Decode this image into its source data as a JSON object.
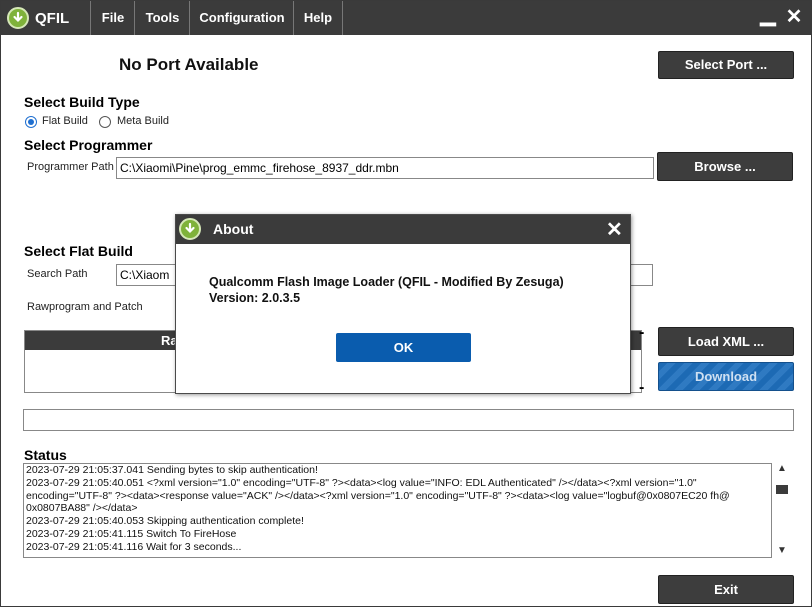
{
  "window": {
    "app_name": "QFIL",
    "minimize": "▁",
    "close": "✕"
  },
  "menu": [
    "File",
    "Tools",
    "Configuration",
    "Help"
  ],
  "port": {
    "status": "No Port Available",
    "select_button": "Select Port ..."
  },
  "build_type": {
    "heading": "Select Build Type",
    "options": [
      "Flat Build",
      "Meta Build"
    ],
    "selected": "Flat Build"
  },
  "programmer": {
    "heading": "Select Programmer",
    "label": "Programmer Path",
    "path": "C:\\Xiaomi\\Pine\\prog_emmc_firehose_8937_ddr.mbn",
    "browse_button": "Browse ..."
  },
  "flat_build": {
    "heading": "Select Flat Build",
    "search_label": "Search Path",
    "search_value": "C:\\Xiaom",
    "rawprogram_label": "Rawprogram and Patch",
    "table_header": "Ra",
    "load_xml_button": "Load XML ...",
    "download_button": "Download",
    "dash": "-"
  },
  "status": {
    "heading": "Status",
    "lines": [
      "2023-07-29 21:05:37.041     Sending bytes to skip authentication!",
      "2023-07-29 21:05:40.051     <?xml version=\"1.0\" encoding=\"UTF-8\" ?><data><log value=\"INFO: EDL Authenticated\" /></data><?xml version=\"1.0\"",
      "encoding=\"UTF-8\" ?><data><response value=\"ACK\" /></data><?xml version=\"1.0\" encoding=\"UTF-8\" ?><data><log value=\"logbuf@0x0807EC20 fh@",
      "0x0807BA88\" /></data>",
      "2023-07-29 21:05:40.053     Skipping authentication complete!",
      "2023-07-29 21:05:41.115     Switch To FireHose",
      "2023-07-29 21:05:41.116     Wait for 3 seconds..."
    ]
  },
  "exit_button": "Exit",
  "about_dialog": {
    "title": "About",
    "close": "✕",
    "line1": "Qualcomm Flash Image Loader (QFIL - Modified By Zesuga)",
    "line2": "Version: 2.0.3.5",
    "ok_button": "OK"
  },
  "colors": {
    "titlebar": "#3b3b3b",
    "ok_blue": "#0a5cae",
    "download_blue": "#1d6ab4",
    "logo_green": "#7fb23a"
  }
}
